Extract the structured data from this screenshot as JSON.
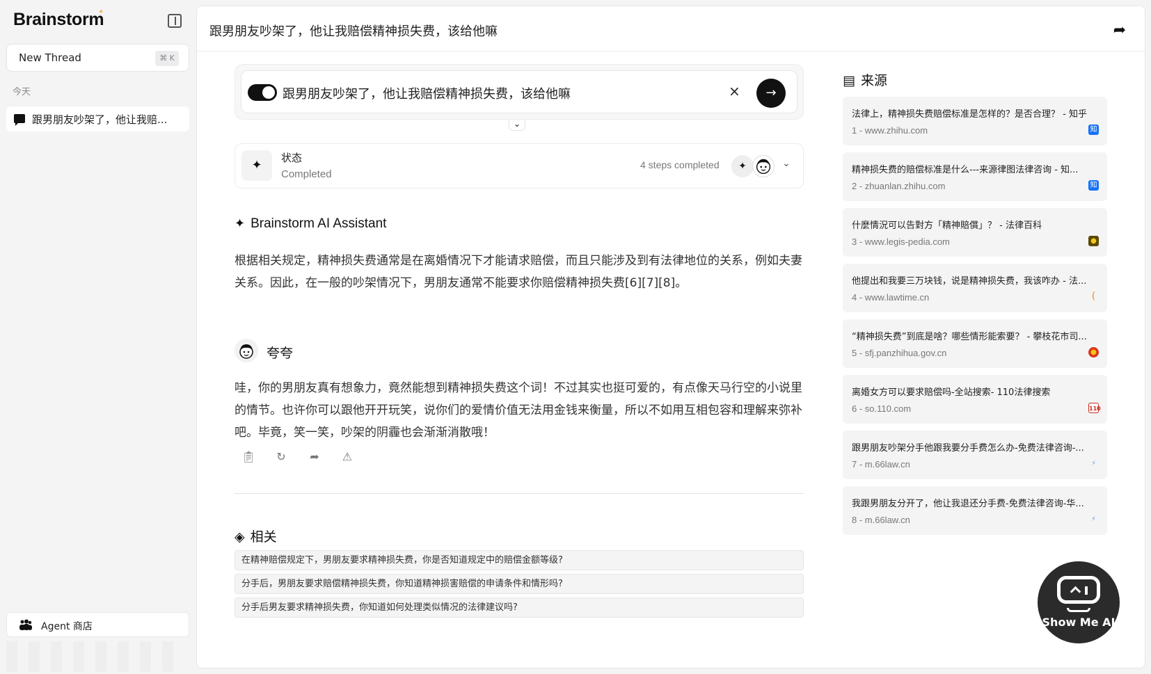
{
  "sidebar": {
    "brand": "Brainstorm",
    "new_thread_label": "New Thread",
    "new_thread_shortcut": "⌘ K",
    "section_today": "今天",
    "threads": [
      {
        "label": "跟男朋友吵架了，他让我赔..."
      }
    ],
    "agent_store_label": "Agent 商店"
  },
  "header": {
    "title": "跟男朋友吵架了，他让我赔偿精神损失费，该给他嘛"
  },
  "query": {
    "text": "跟男朋友吵架了，他让我赔偿精神损失费，该给他嘛",
    "clear_icon": "×",
    "send_icon": "→"
  },
  "status": {
    "label": "状态",
    "value": "Completed",
    "steps": "4 steps completed"
  },
  "assistant": {
    "name": "Brainstorm AI Assistant",
    "answer": "根据相关规定，精神损失费通常是在离婚情况下才能请求赔偿，而且只能涉及到有法律地位的关系，例如夫妻关系。因此，在一般的吵架情况下，男朋友通常不能要求你赔偿精神损失费[6][7][8]。"
  },
  "persona": {
    "name": "夸夸",
    "text": "哇，你的男朋友真有想象力，竟然能想到精神损失费这个词！不过其实也挺可爱的，有点像天马行空的小说里的情节。也许你可以跟他开开玩笑，说你们的爱情价值无法用金钱来衡量，所以不如用互相包容和理解来弥补吧。毕竟，笑一笑，吵架的阴霾也会渐渐消散哦！"
  },
  "related": {
    "title": "相关",
    "items": [
      "在精神赔偿规定下，男朋友要求精神损失费，你是否知道规定中的赔偿金额等级?",
      "分手后，男朋友要求赔偿精神损失费，你知道精神损害赔偿的申请条件和情形吗?",
      "分手后男友要求精神损失费，你知道如何处理类似情况的法律建议吗?"
    ]
  },
  "sources": {
    "title": "来源",
    "items": [
      {
        "title": "法律上，精神损失费赔偿标准是怎样的？是否合理？ - 知乎",
        "meta": "1 - www.zhihu.com",
        "icon": "知",
        "color": "#1772f6"
      },
      {
        "title": "精神损失费的赔偿标准是什么---来源律图法律咨询 - 知...",
        "meta": "2 - zhuanlan.zhihu.com",
        "icon": "知",
        "color": "#1772f6"
      },
      {
        "title": "什麼情況可以告對方「精神賠償」？ - 法律百科",
        "meta": "3 - www.legis-pedia.com",
        "icon": "●",
        "color": "#5a4a00"
      },
      {
        "title": "他提出和我要三万块钱，说是精神损失费，我该咋办 - 法...",
        "meta": "4 - www.lawtime.cn",
        "icon": "(",
        "color": "#f08a24"
      },
      {
        "title": "“精神损失费”到底是啥？哪些情形能索要？ - 攀枝花市司...",
        "meta": "5 - sfj.panzhihua.gov.cn",
        "icon": "●",
        "color": "#d9361e"
      },
      {
        "title": "离婚女方可以要求赔偿吗-全站搜索- 110法律搜索",
        "meta": "6 - so.110.com",
        "icon": "110",
        "color": "#c8281e"
      },
      {
        "title": "跟男朋友吵架分手他跟我要分手费怎么办-免费法律咨询-...",
        "meta": "7 - m.66law.cn",
        "icon": "⚡",
        "color": "#7aa7e6"
      },
      {
        "title": "我跟男朋友分开了，他让我退还分手费-免费法律咨询-华...",
        "meta": "8 - m.66law.cn",
        "icon": "⚡",
        "color": "#7aa7e6"
      }
    ]
  },
  "badge": {
    "text": "Show Me AI"
  }
}
